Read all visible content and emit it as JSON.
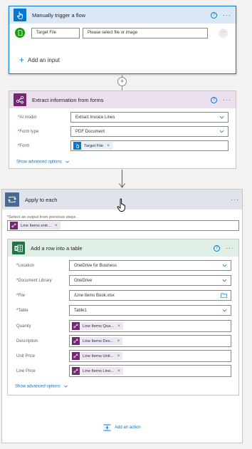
{
  "trigger": {
    "title": "Manually trigger a flow",
    "help": "?",
    "more": "···",
    "file_label": "Target File",
    "file_placeholder": "Please select file or image",
    "ellipsis": "···",
    "add_input": "Add an input"
  },
  "extract": {
    "title": "Extract information from forms",
    "help": "?",
    "more": "···",
    "ai_model_label": "AI model",
    "ai_model_value": "Extract Invoice Lines",
    "form_type_label": "Form type",
    "form_type_value": "PDF Document",
    "form_label": "Form",
    "form_token": "Target File",
    "advanced": "Show advanced options"
  },
  "apply": {
    "title": "Apply to each",
    "more": "···",
    "select_label": "Select an output from previous steps",
    "token": "Line Items entr..."
  },
  "add_row": {
    "title": "Add a row into a table",
    "help": "?",
    "more": "···",
    "location_label": "Location",
    "location_value": "OneDrive for Business",
    "doclib_label": "Document Library",
    "doclib_value": "OneDrive",
    "file_label": "File",
    "file_value": "/Line Items Book.xlsx",
    "table_label": "Table",
    "table_value": "Table1",
    "quantity_label": "Quanity",
    "quantity_token": "Line Items Qua...",
    "description_label": "Description",
    "description_token": "Line Items Des...",
    "unit_price_label": "Unit Price",
    "unit_price_token": "Line Items Unit...",
    "line_price_label": "Line Price",
    "line_price_token": "Line Items Line...",
    "advanced": "Show advanced options"
  },
  "add_action": "Add an action",
  "required_mark": "*",
  "token_remove": "×",
  "colors": {
    "trigger_header": "#dbe8f7",
    "trigger_border": "#0078d4",
    "extract_header": "#ecdfee",
    "extract_icon": "#742774",
    "apply_header": "#dfe3ea",
    "apply_icon": "#486991",
    "excel_header": "#e0efe5",
    "excel_icon": "#217346",
    "accent": "#0078d4"
  }
}
